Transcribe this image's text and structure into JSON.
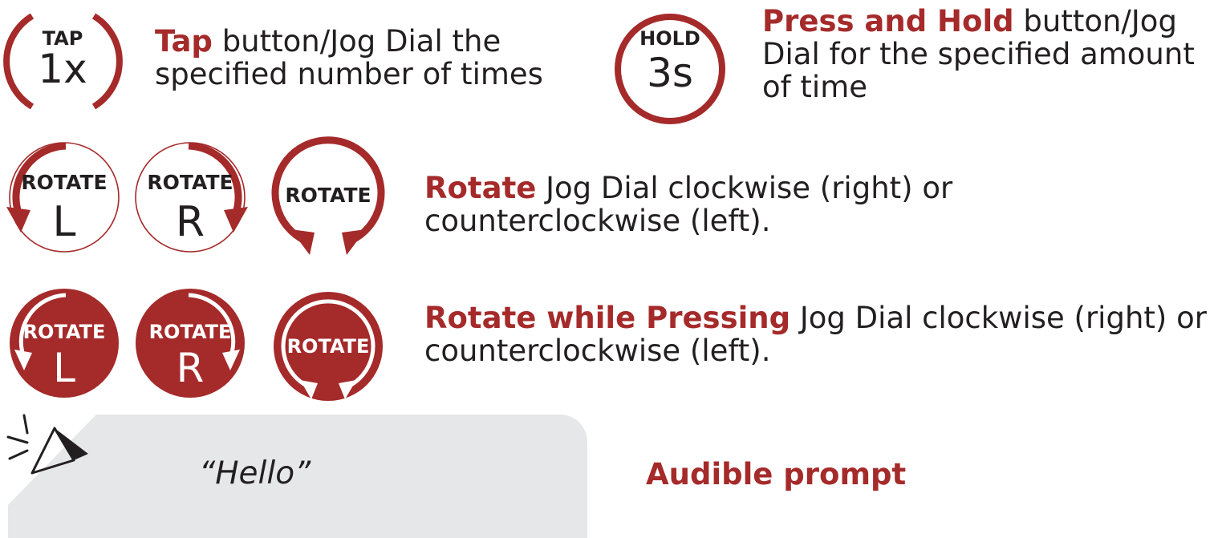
{
  "colors": {
    "accent": "#a52a2a",
    "text": "#231f20",
    "bubble": "#e6e7e8"
  },
  "tap": {
    "icon_top": "TAP",
    "icon_main": "1x",
    "keyword": "Tap",
    "line1_rest": " button/Jog Dial the",
    "line2": "specified number of times"
  },
  "hold": {
    "icon_top": "HOLD",
    "icon_main": "3s",
    "keyword": "Press and Hold",
    "line1_rest": " button/Jog",
    "line2": "Dial for the specified amount",
    "line3": "of time"
  },
  "rotate": {
    "icon_label": "ROTATE",
    "left_letter": "L",
    "right_letter": "R",
    "keyword": "Rotate",
    "line1_rest": " Jog Dial clockwise (right) or",
    "line2": "counterclockwise (left)."
  },
  "rotate_press": {
    "icon_label": "ROTATE",
    "left_letter": "L",
    "right_letter": "R",
    "keyword": "Rotate while Pressing",
    "line1_rest": " Jog Dial clockwise (right) or",
    "line2": "counterclockwise (left)."
  },
  "audible": {
    "icon": "speaker-icon",
    "example": "“Hello”",
    "label": "Audible prompt"
  }
}
